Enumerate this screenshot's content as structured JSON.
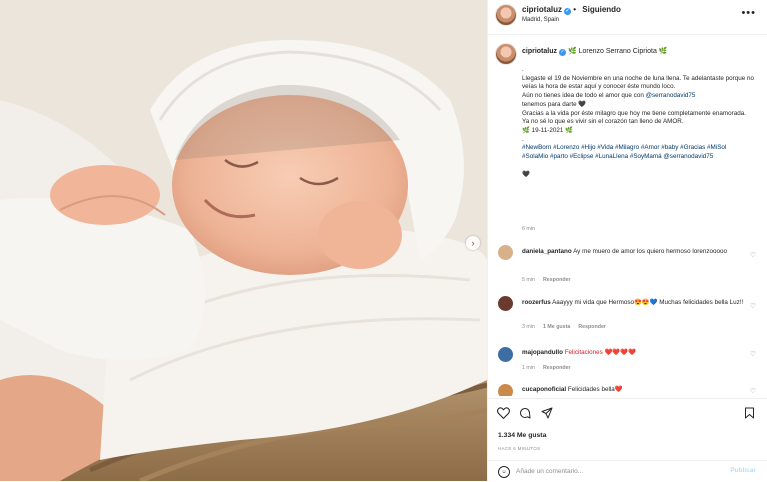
{
  "colors": {
    "link": "#00376b",
    "verified": "#3897f0",
    "muted": "#8e8e8e",
    "publish_disabled": "#b2dffc"
  },
  "header": {
    "username": "cipriotaluz",
    "follow_status": "Siguiendo",
    "location": "Madrid, Spain",
    "more_icon": "more-horizontal-icon"
  },
  "caption": {
    "username": "cipriotaluz",
    "title": "🌿 Lorenzo Serrano Cipriota 🌿",
    "lines": [
      ".",
      "Llegaste el 19 de Noviembre en una noche de luna llena. Te adelantaste porque no veías la hora de estar aquí y conocer éste mundo loco.",
      "Aún no tienes idea de todo el amor que con",
      "tenemos para darte 🖤",
      "Gracias a la vida por éste milagro que hoy me tiene completamente enamorada. Ya no sé lo que es vivir sin el corazón tan lleno de AMOR.",
      "🌿 19-11-2021 🌿",
      "."
    ],
    "mention": "@serranodavid75",
    "hashtags": "#NewBorn #Lorenzo #Hijo #Vida #Milagro #Amor #baby #Gracias #MiSol #SolaMio #parto #Eclipse #LunaLlena #SoyMamá @serranodavid75",
    "end_mark": "🖤",
    "time": "6 min"
  },
  "comments": [
    {
      "username": "daniela_pantano",
      "text": "Ay me muero de amor los quiero hermoso lorenzooooo",
      "time": "5 min",
      "likes": "",
      "reply": "Responder",
      "avatar_color": "#d8b08a"
    },
    {
      "username": "roozerfus",
      "text": "Aaayyy mi vida que Hermoso😍😍💙 Muchas felicidades bella Luz!!",
      "time": "3 min",
      "likes": "1 Me gusta",
      "reply": "Responder",
      "avatar_color": "#6b3a2e"
    },
    {
      "username": "majopandullo",
      "text": "Felicitaciones ❤️❤️❤️❤️",
      "time": "1 min",
      "likes": "",
      "reply": "Responder",
      "avatar_color": "#3c6ea5"
    },
    {
      "username": "cucaponoficial",
      "text": "Felicidades bella❤️",
      "time": "",
      "likes": "",
      "reply": "",
      "avatar_color": "#c98a4a"
    }
  ],
  "actions": {
    "like_icon": "heart-icon",
    "comment_icon": "comment-icon",
    "share_icon": "share-icon",
    "save_icon": "bookmark-icon"
  },
  "likes_text": "1.334 Me gusta",
  "posted_ago": "HACE 6 MINUTOS",
  "comment_box": {
    "placeholder": "Añade un comentario...",
    "value": "",
    "publish_label": "Publicar",
    "emoji_icon": "emoji-icon"
  }
}
